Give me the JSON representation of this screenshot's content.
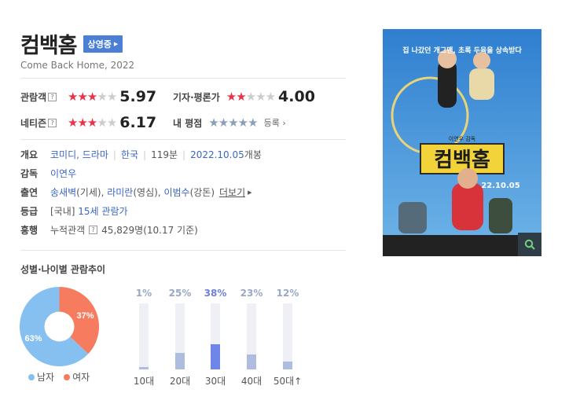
{
  "header": {
    "title": "컴백홈",
    "badge": "상영중",
    "subtitle": "Come Back Home, 2022"
  },
  "ratings": {
    "audience": {
      "label": "관람객",
      "score": "5.97",
      "stars": 3
    },
    "critics": {
      "label": "기자·평론가",
      "score": "4.00",
      "stars": 2
    },
    "netizen": {
      "label": "네티즌",
      "score": "6.17",
      "stars": 3
    },
    "mine": {
      "label": "내 평점",
      "register": "등록"
    }
  },
  "info": {
    "overview_label": "개요",
    "genre": "코미디, 드라마",
    "country": "한국",
    "runtime": "119분",
    "release_date": "2022.10.05",
    "release_suffix": "개봉",
    "director_label": "감독",
    "director": "이연우",
    "cast_label": "출연",
    "cast_1": "송새벽",
    "cast_1_role": "(기세)",
    "cast_2": "라미란",
    "cast_2_role": "(영심)",
    "cast_3": "이범수",
    "cast_3_role": "(강돈)",
    "more": "더보기",
    "rating_label": "등급",
    "rating_prefix": "[국내]",
    "rating_value": "15세 관람가",
    "boxoffice_label": "흥행",
    "boxoffice_key": "누적관객",
    "boxoffice_value": "45,829명",
    "boxoffice_date": "(10.17 기준)"
  },
  "trend": {
    "title": "성별·나이별 관람추이",
    "legend_male": "남자",
    "legend_female": "여자",
    "male_color": "#86c0f0",
    "female_color": "#f77b5f"
  },
  "chart_data": [
    {
      "type": "pie",
      "labels": [
        "남자",
        "여자"
      ],
      "values": [
        63,
        37
      ],
      "data_labels": [
        "63%",
        "37%"
      ]
    },
    {
      "type": "bar",
      "categories": [
        "10대",
        "20대",
        "30대",
        "40대",
        "50대↑"
      ],
      "values": [
        1,
        25,
        38,
        23,
        12
      ],
      "data_labels": [
        "1%",
        "25%",
        "38%",
        "23%",
        "12%"
      ],
      "ylim": [
        0,
        100
      ]
    }
  ],
  "poster": {
    "top_text": "집 나갔던 개그맨, 초록 두육을 상속받다",
    "title_text": "컴백홈",
    "date_text": "22.10.05",
    "credit_text": "이연우 감독"
  },
  "icons": {
    "zoom": "magnifier-icon",
    "help": "help-icon"
  }
}
